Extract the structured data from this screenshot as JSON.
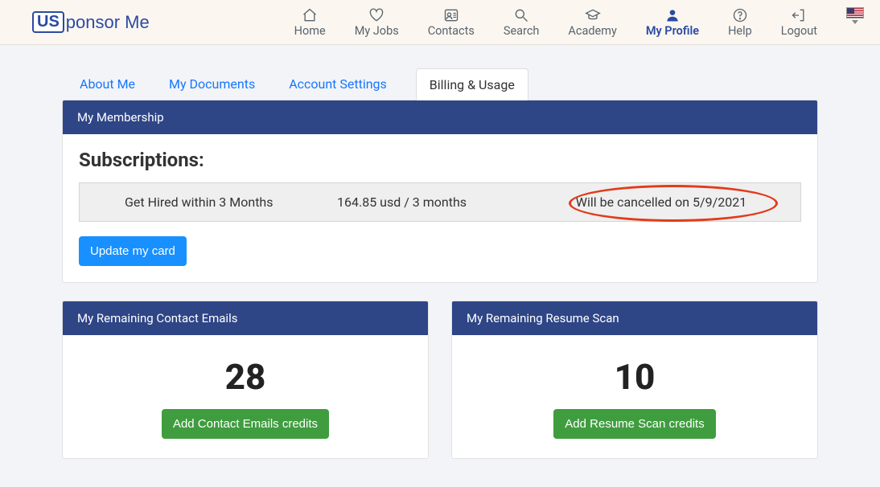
{
  "logo": {
    "box": "US",
    "rest": "ponsor Me"
  },
  "nav": {
    "home": "Home",
    "myjobs": "My Jobs",
    "contacts": "Contacts",
    "search": "Search",
    "academy": "Academy",
    "myprofile": "My Profile",
    "help": "Help",
    "logout": "Logout"
  },
  "tabs": {
    "about": "About Me",
    "docs": "My Documents",
    "settings": "Account Settings",
    "billing": "Billing & Usage"
  },
  "membership": {
    "header": "My Membership",
    "title": "Subscriptions:",
    "plan": "Get Hired within 3 Months",
    "price": "164.85 usd / 3 months",
    "status": "Will be cancelled on 5/9/2021",
    "update_btn": "Update my card"
  },
  "emails": {
    "header": "My Remaining Contact Emails",
    "count": "28",
    "btn": "Add Contact Emails credits"
  },
  "resume": {
    "header": "My Remaining Resume Scan",
    "count": "10",
    "btn": "Add Resume Scan credits"
  }
}
